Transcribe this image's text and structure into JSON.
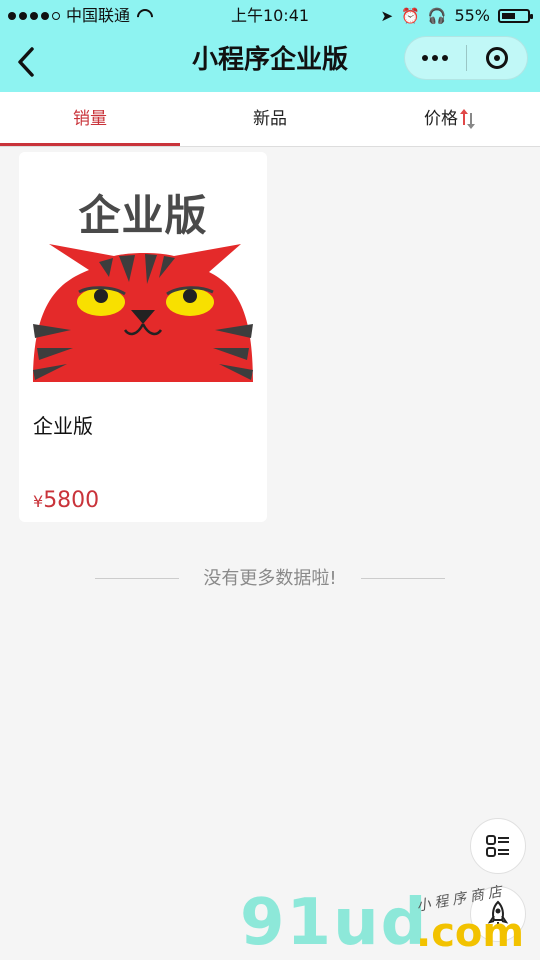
{
  "status_bar": {
    "carrier": "中国联通",
    "time": "上午10:41",
    "battery_percent": "55%",
    "battery_level": 0.55
  },
  "nav": {
    "title": "小程序企业版",
    "back_icon": "chevron-left-icon",
    "more_icon": "more-dots-icon",
    "close_icon": "target-circle-icon"
  },
  "tabs": [
    {
      "label": "销量",
      "active": true
    },
    {
      "label": "新品",
      "active": false
    },
    {
      "label": "价格",
      "active": false
    }
  ],
  "products": [
    {
      "image_text": "企业版",
      "name": "企业版",
      "currency": "¥",
      "price": "5800"
    }
  ],
  "no_more_text": "没有更多数据啦!",
  "floating_buttons": {
    "list_icon": "list-grid-icon",
    "rocket_icon": "rocket-icon"
  },
  "watermark": {
    "main": "91ud",
    "suffix": ".com",
    "tagline": "小程序商店"
  },
  "colors": {
    "header_bg": "#8ef3f1",
    "accent": "#c9333a",
    "page_bg": "#f5f5f5"
  }
}
